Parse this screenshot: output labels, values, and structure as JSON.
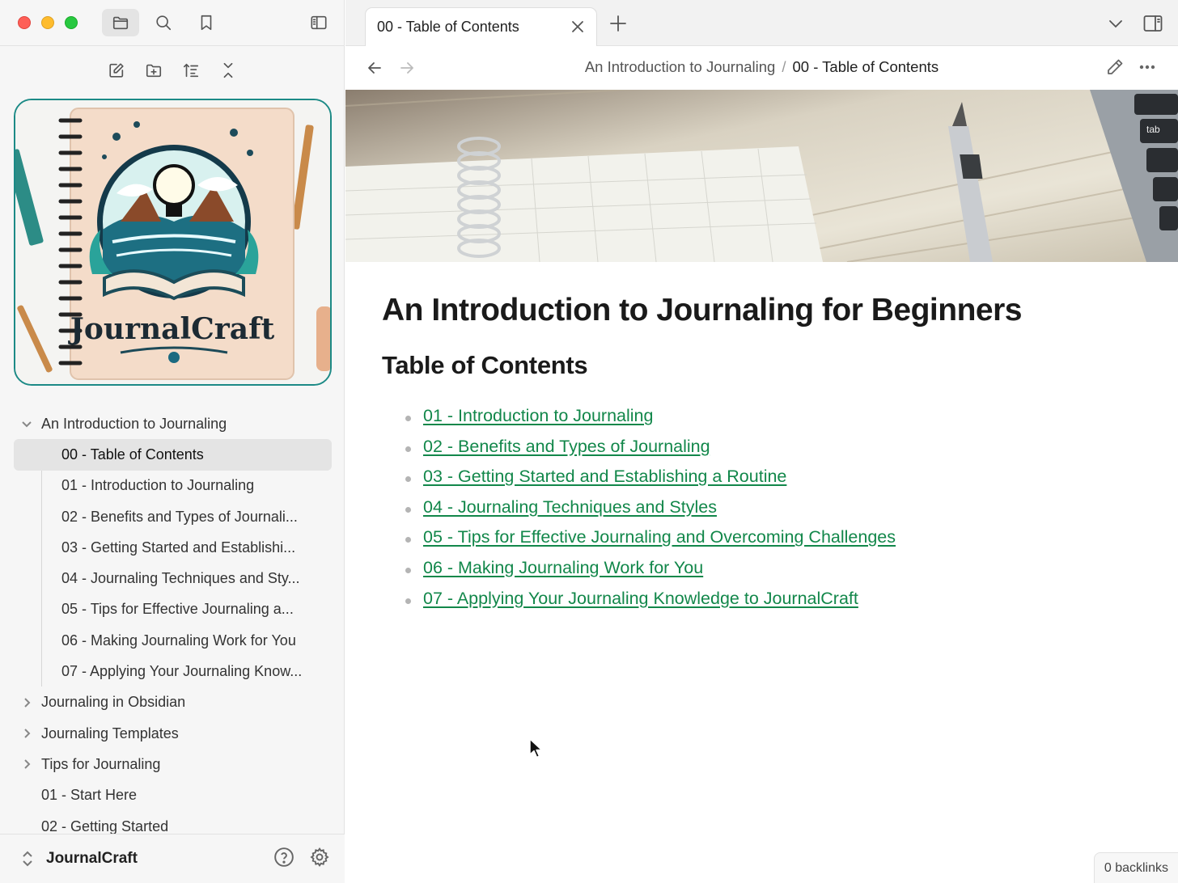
{
  "sidebar": {
    "toolbar": {
      "files_icon": "folder-icon",
      "search_icon": "search-icon",
      "bookmarks_icon": "bookmark-icon",
      "toggle_icon": "sidebar-toggle-icon"
    },
    "actions": [
      "new-note-icon",
      "new-folder-icon",
      "sort-icon",
      "collapse-all-icon"
    ],
    "cover": {
      "text": "JournalCraft"
    },
    "tree": {
      "folder_open": "An Introduction to Journaling",
      "children": [
        "00 - Table of Contents",
        "01 - Introduction to Journaling",
        "02 - Benefits and Types of Journali...",
        "03 - Getting Started and Establishi...",
        "04 - Journaling Techniques and Sty...",
        "05 - Tips for Effective Journaling a...",
        "06 - Making Journaling Work for You",
        "07 - Applying Your Journaling Know..."
      ],
      "folders": [
        "Journaling in Obsidian",
        "Journaling Templates",
        "Tips for Journaling"
      ],
      "files": [
        "01 - Start Here",
        "02 - Getting Started"
      ]
    },
    "footer": {
      "vault_name": "JournalCraft"
    }
  },
  "tabs": [
    {
      "title": "00 - Table of Contents",
      "active": true
    }
  ],
  "breadcrumb": {
    "parent": "An Introduction to Journaling",
    "separator": "/",
    "current": "00 - Table of Contents"
  },
  "document": {
    "title": "An Introduction to Journaling for Beginners",
    "subtitle": "Table of Contents",
    "links": [
      "01 - Introduction to Journaling",
      "02 - Benefits and Types of Journaling",
      "03 - Getting Started and Establishing a Routine",
      "04 - Journaling Techniques and Styles",
      "05 - Tips for Effective Journaling and Overcoming Challenges",
      "06 - Making Journaling Work for You",
      "07 - Applying Your Journaling Knowledge to JournalCraft"
    ]
  },
  "status": {
    "backlinks": "0 backlinks"
  },
  "colors": {
    "link": "#12874a",
    "accent_border": "#1c8a86",
    "selected_bg": "#e4e4e4"
  }
}
